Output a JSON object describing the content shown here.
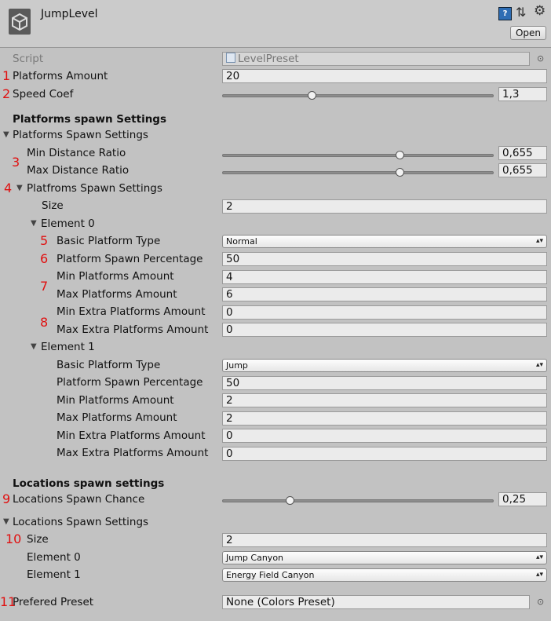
{
  "header": {
    "title": "JumpLevel",
    "help_icon": "?",
    "open_label": "Open"
  },
  "script": {
    "label": "Script",
    "value": "LevelPreset"
  },
  "platforms_amount": {
    "label": "Platforms Amount",
    "value": "20"
  },
  "speed_coef": {
    "label": "Speed Coef",
    "value": "1,3",
    "slider_fraction": 0.33
  },
  "platforms_header": "Platforms spawn Settings",
  "platforms_foldout": "Platforms Spawn Settings",
  "min_distance": {
    "label": "Min Distance Ratio",
    "value": "0,655",
    "slider_fraction": 0.655
  },
  "max_distance": {
    "label": "Max Distance Ratio",
    "value": "0,655",
    "slider_fraction": 0.655
  },
  "platfroms_foldout": "Platfroms Spawn Settings",
  "size": {
    "label": "Size",
    "value": "2"
  },
  "elements": [
    {
      "label": "Element 0",
      "basic_type": {
        "label": "Basic Platform Type",
        "value": "Normal"
      },
      "spawn_pct": {
        "label": "Platform Spawn Percentage",
        "value": "50"
      },
      "min_amount": {
        "label": "Min Platforms Amount",
        "value": "4"
      },
      "max_amount": {
        "label": "Max Platforms Amount",
        "value": "6"
      },
      "min_extra": {
        "label": "Min Extra Platforms Amount",
        "value": "0"
      },
      "max_extra": {
        "label": "Max Extra Platforms Amount",
        "value": "0"
      }
    },
    {
      "label": "Element 1",
      "basic_type": {
        "label": "Basic Platform Type",
        "value": "Jump"
      },
      "spawn_pct": {
        "label": "Platform Spawn Percentage",
        "value": "50"
      },
      "min_amount": {
        "label": "Min Platforms Amount",
        "value": "2"
      },
      "max_amount": {
        "label": "Max Platforms Amount",
        "value": "2"
      },
      "min_extra": {
        "label": "Min Extra Platforms Amount",
        "value": "0"
      },
      "max_extra": {
        "label": "Max Extra Platforms Amount",
        "value": "0"
      }
    }
  ],
  "locations_header": "Locations spawn settings",
  "locations_chance": {
    "label": "Locations Spawn Chance",
    "value": "0,25",
    "slider_fraction": 0.25
  },
  "locations_foldout": "Locations Spawn Settings",
  "locations_size": {
    "label": "Size",
    "value": "2"
  },
  "location_elements": [
    {
      "label": "Element 0",
      "value": "Jump Canyon"
    },
    {
      "label": "Element 1",
      "value": "Energy Field Canyon"
    }
  ],
  "prefered_preset": {
    "label": "Prefered Preset",
    "value": "None (Colors Preset)"
  },
  "annotations": [
    "1",
    "2",
    "3",
    "4",
    "5",
    "6",
    "7",
    "8",
    "9",
    "10",
    "11"
  ]
}
